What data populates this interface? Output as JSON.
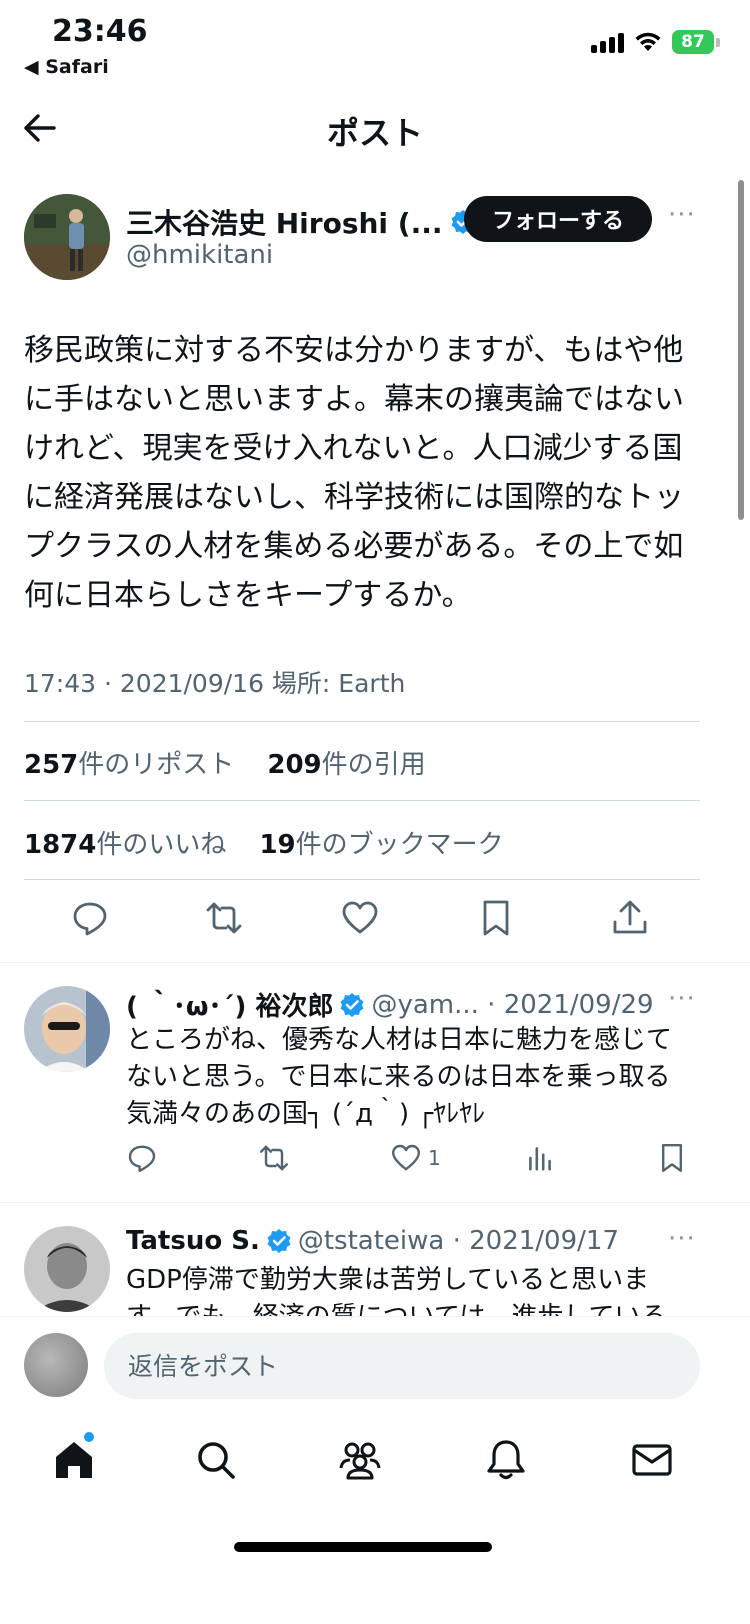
{
  "status_bar": {
    "time": "23:46",
    "back_app": "◀ Safari",
    "battery": "87"
  },
  "nav": {
    "title": "ポスト"
  },
  "post": {
    "author_name": "三木谷浩史 Hiroshi (...",
    "author_handle": "@hmikitani",
    "follow_label": "フォローする",
    "more": "···",
    "text": "移民政策に対する不安は分かりますが、もはや他\nに手はないと思いますよ。幕末の攘夷論ではない\nけれど、現実を受け入れないと。人口減少する国\nに経済発展はないし、科学技術には国際的なトッ\nプクラスの人材を集める必要がある。その上で如\n何に日本らしさをキープするか。",
    "meta": "17:43 · 2021/09/16 場所: Earth",
    "reposts_count": "257",
    "reposts_label": "件のリポスト",
    "quotes_count": "209",
    "quotes_label": "件の引用",
    "likes_count": "1874",
    "likes_label": "件のいいね",
    "bookmarks_count": "19",
    "bookmarks_label": "件のブックマーク"
  },
  "replies": [
    {
      "name": "( ｀･ω･´) 裕次郎",
      "meta": "@yam... · 2021/09/29",
      "text": "ところがね、優秀な人材は日本に魅力を感じて\nないと思う。で日本に来るのは日本を乗っ取る\n気満々のあの国┐ (´д｀) ┌ﾔﾚﾔﾚ",
      "like_count": "1",
      "more": "···"
    },
    {
      "name": "Tatsuo S.",
      "meta": "@tstateiwa · 2021/09/17",
      "text": "GDP停滞で勤労大衆は苦労していると思いま\nす。でも、経済の質については、進歩している",
      "more": "···"
    }
  ],
  "composer": {
    "placeholder": "返信をポスト"
  },
  "colors": {
    "accent": "#1d9bf0",
    "text": "#0f1419",
    "muted": "#536471",
    "battery": "#34c759"
  },
  "icons": {
    "nav": "arrow-left-icon",
    "actions": [
      "reply-icon",
      "repost-icon",
      "like-icon",
      "bookmark-icon",
      "share-icon"
    ],
    "tabs": [
      "home-icon",
      "search-icon",
      "communities-icon",
      "notifications-icon",
      "messages-icon"
    ]
  }
}
